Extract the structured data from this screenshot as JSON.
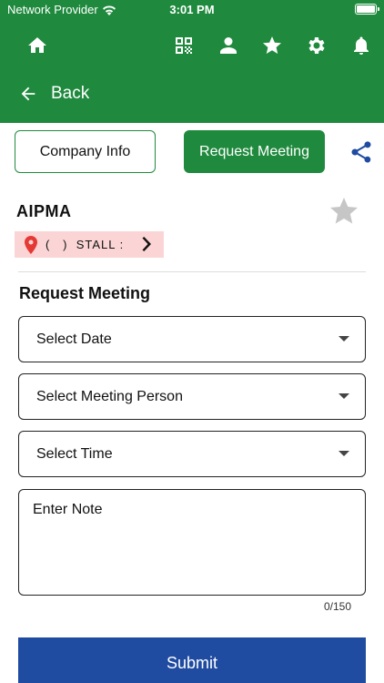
{
  "statusbar": {
    "carrier": "Network Provider",
    "time": "3:01 PM"
  },
  "toolbar": {
    "icons": [
      "home-icon",
      "qr-code-icon",
      "person-icon",
      "star-icon",
      "settings-icon",
      "bell-icon"
    ]
  },
  "nav": {
    "back_label": "Back"
  },
  "tabs": {
    "company_info": "Company Info",
    "request_meeting": "Request Meeting"
  },
  "company": {
    "name": "AIPMA",
    "stall_text": "(   )  STALL :"
  },
  "form": {
    "title": "Request Meeting",
    "date_placeholder": "Select Date",
    "person_placeholder": "Select Meeting Person",
    "time_placeholder": "Select Time",
    "note_placeholder": "Enter Note",
    "note_counter": "0/150",
    "submit_label": "Submit"
  },
  "colors": {
    "primary_green": "#1f8a3e",
    "primary_blue": "#1f4ba0",
    "stall_bg": "#fbd5d5",
    "pin_red": "#e53935"
  }
}
